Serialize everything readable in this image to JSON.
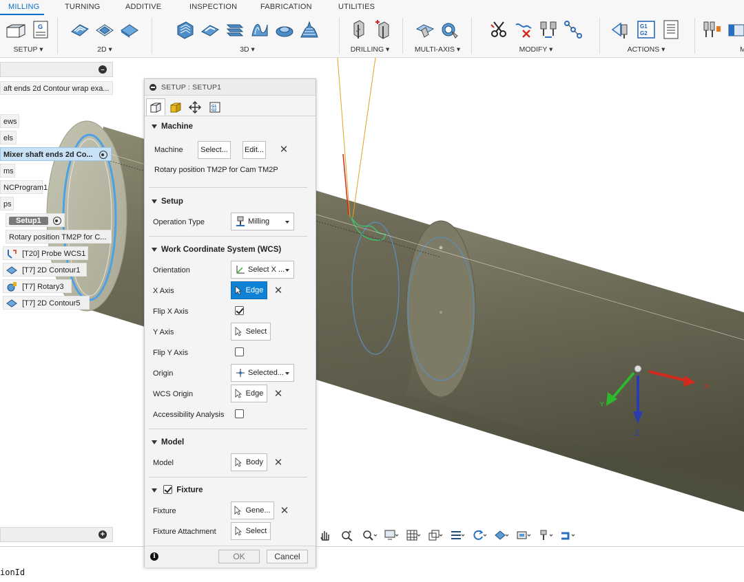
{
  "ribbon": {
    "tabs": [
      "MILLING",
      "TURNING",
      "ADDITIVE",
      "INSPECTION",
      "FABRICATION",
      "UTILITIES"
    ],
    "groups": {
      "setup": "SETUP ▾",
      "g2d": "2D ▾",
      "g3d": "3D ▾",
      "drilling": "DRILLING ▾",
      "multiaxis": "MULTI-AXIS ▾",
      "modify": "MODIFY ▾",
      "actions": "ACTIONS ▾",
      "manage_partial": "M"
    },
    "icons": {
      "setup": [
        "new-setup-icon",
        "nc-program-icon"
      ],
      "g2d": [
        "2d-pocket-icon",
        "facing-icon",
        "2d-contour-icon"
      ],
      "g3d": [
        "adaptive-clearing-icon",
        "pocket-clearing-icon",
        "steep-shallow-icon",
        "parallel-icon",
        "scallop-icon",
        "contour-3d-icon"
      ],
      "drilling": [
        "drill-icon",
        "hole-recognition-icon"
      ],
      "multiaxis": [
        "swarf-icon",
        "multiaxis-contour-icon"
      ],
      "modify": [
        "cut-icon",
        "delete-toolpath-icon",
        "compare-tools-icon",
        "pattern-icon"
      ],
      "actions": [
        "simulate-icon",
        "post-process-icon",
        "setup-sheet-icon"
      ],
      "manage": [
        "tool-library-icon",
        "template-icon"
      ]
    },
    "accent": "#0b6fc6"
  },
  "browser": {
    "nodes": [
      {
        "label": "aft ends 2d Contour wrap exa..."
      },
      {
        "label": "ews"
      },
      {
        "label": "els"
      },
      {
        "label": "Mixer shaft ends 2d Co..."
      },
      {
        "label": "ms"
      },
      {
        "label": "NCProgram1"
      },
      {
        "label": "ps"
      },
      {
        "label": "Setup1"
      },
      {
        "label": "Rotary position TM2P for C..."
      },
      {
        "label": "[T20] Probe WCS1"
      },
      {
        "label": "[T7] 2D Contour1"
      },
      {
        "label": "[T7] Rotary3"
      },
      {
        "label": "[T7] 2D Contour5"
      }
    ],
    "icons": [
      "collapse-icon",
      "visibility-icon",
      "probe-icon",
      "2d-contour-op-icon",
      "rotary-op-icon"
    ]
  },
  "dialog": {
    "title": "SETUP : SETUP1",
    "tabs": [
      "setup-tab-icon",
      "stock-tab-icon",
      "post-process-tab-icon",
      "nc-tab-icon"
    ],
    "machine": {
      "header": "Machine",
      "label": "Machine",
      "select": "Select...",
      "edit": "Edit...",
      "info": "Rotary position TM2P for Cam  TM2P"
    },
    "setup": {
      "header": "Setup",
      "op_type_label": "Operation Type",
      "op_type_value": "Milling"
    },
    "wcs": {
      "header": "Work Coordinate System (WCS)",
      "orientation_label": "Orientation",
      "orientation_value": "Select X ...",
      "xaxis_label": "X Axis",
      "xaxis_value": "Edge",
      "flipx_label": "Flip X Axis",
      "flipx_checked": true,
      "yaxis_label": "Y Axis",
      "yaxis_value": "Select",
      "flipy_label": "Flip Y Axis",
      "flipy_checked": false,
      "origin_label": "Origin",
      "origin_value": "Selected...",
      "wcs_origin_label": "WCS Origin",
      "wcs_origin_value": "Edge",
      "access_label": "Accessibility Analysis",
      "access_checked": false
    },
    "model": {
      "header": "Model",
      "label": "Model",
      "value": "Body"
    },
    "fixture": {
      "header": "Fixture",
      "enabled": true,
      "label": "Fixture",
      "value": "Gene...",
      "attach_label": "Fixture Attachment",
      "attach_value": "Select"
    },
    "ok": "OK",
    "cancel": "Cancel",
    "accent": "#0f82d6"
  },
  "viewport": {
    "axis_x": "X",
    "axis_y": "Y",
    "axis_z": "Z",
    "colors": {
      "x": "#d42a1e",
      "y": "#2db82d",
      "z": "#2a3cae",
      "part": "#6d6c5a"
    }
  },
  "navbar": {
    "icons": [
      "orbit-pan-icon",
      "zoom-window-icon",
      "zoom-icon",
      "display-settings-icon",
      "grid-icon",
      "view-cube-icon",
      "section-icon",
      "refresh-icon",
      "material-icon",
      "stock-display-icon",
      "tool-display-icon",
      "toolpath-display-icon"
    ]
  },
  "comments": {
    "toggle": "+"
  },
  "status": {
    "text": "ionId"
  }
}
